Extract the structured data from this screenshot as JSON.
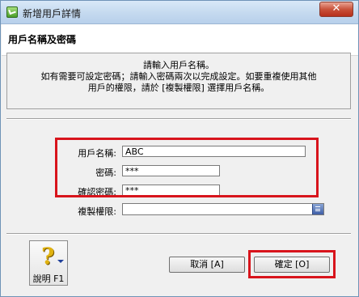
{
  "window": {
    "title": "新增用戶詳情",
    "close_glyph": "✕"
  },
  "header": {
    "section_title": "用戶名稱及密碼"
  },
  "info": {
    "lines": [
      "請輸入用戶名稱。",
      "如有需要可設定密碼；請輸入密碼兩次以完成設定。如要重複使用其他",
      "用戶的權限，請於 [複製權限] 選擇用戶名稱。"
    ]
  },
  "form": {
    "username_label": "用戶名稱:",
    "username_value": "ABC",
    "password_label": "密碼:",
    "password_value": "***",
    "confirm_label": "確認密碼:",
    "confirm_value": "***",
    "copy_label": "複製權限:",
    "copy_value": ""
  },
  "buttons": {
    "help_label": "說明 F1",
    "help_glyph": "?",
    "cancel_label": "取消 [A]",
    "ok_label": "確定 [O]"
  },
  "icons": {
    "app": "app-icon",
    "close": "close-icon",
    "help": "help-icon",
    "dropdown": "dropdown-arrow-icon"
  },
  "colors": {
    "highlight": "#d8141c",
    "close_button": "#c9523a",
    "help_icon": "#e0b210"
  }
}
